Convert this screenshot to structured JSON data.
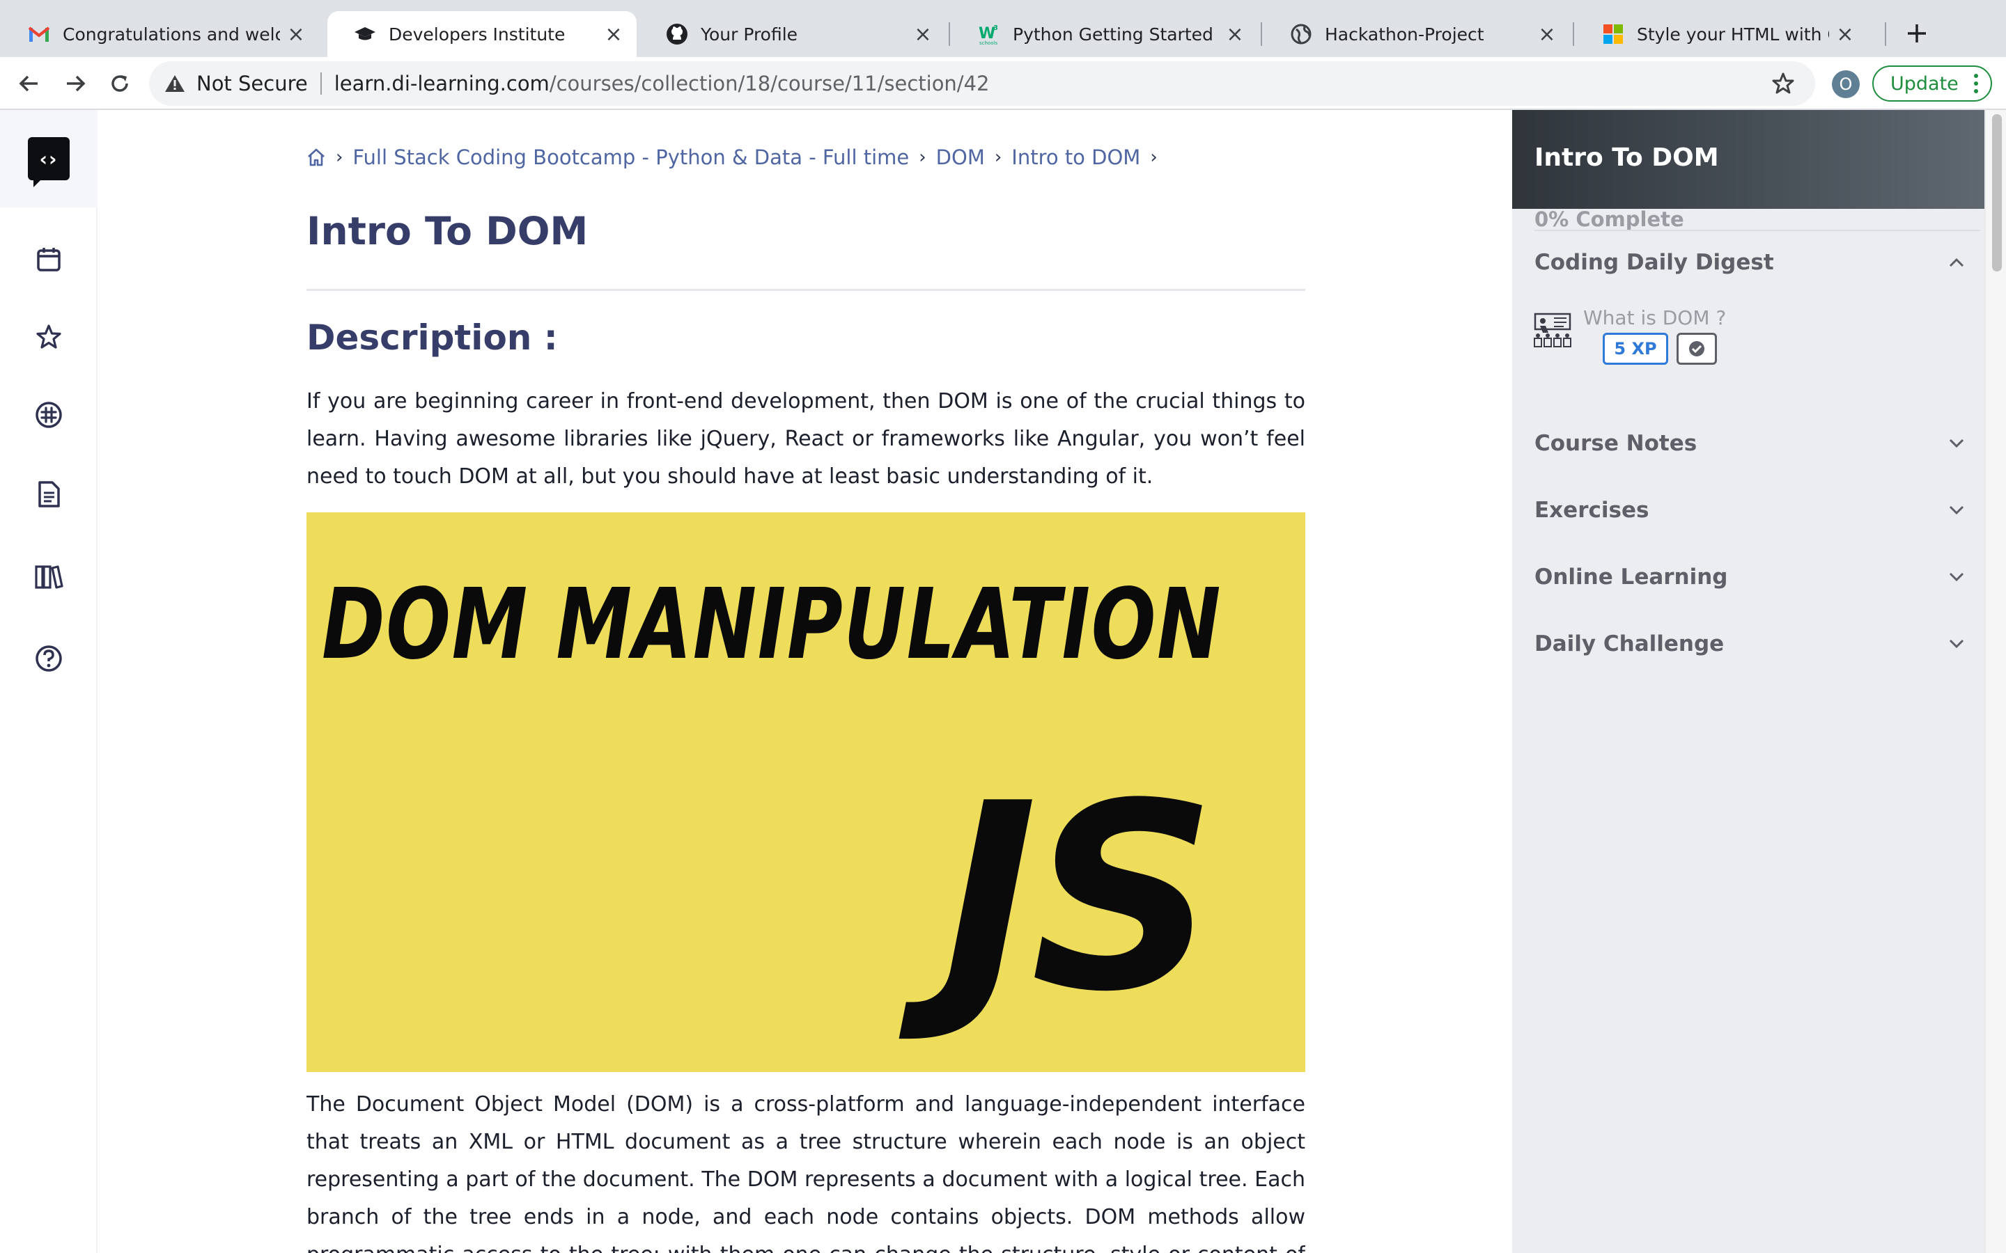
{
  "browser": {
    "tabs": [
      {
        "title": "Congratulations and welcome to the Developers Institute",
        "icon": "gmail-icon"
      },
      {
        "title": "Developers Institute",
        "icon": "graduation-cap-icon"
      },
      {
        "title": "Your Profile",
        "icon": "github-icon"
      },
      {
        "title": "Python Getting Started",
        "icon": "w3schools-icon"
      },
      {
        "title": "Hackathon-Project",
        "icon": "globe-icon"
      },
      {
        "title": "Style your HTML with CSS - Learn",
        "icon": "microsoft-icon"
      }
    ],
    "active_tab": 1,
    "security_label": "Not Secure",
    "url_host": "learn.di-learning.com",
    "url_path": "/courses/collection/18/course/11/section/42",
    "profile_initial": "O",
    "update_label": "Update"
  },
  "breadcrumb": {
    "items": [
      "Full Stack Coding Bootcamp - Python & Data - Full time",
      "DOM",
      "Intro to DOM"
    ]
  },
  "page": {
    "title": "Intro To DOM",
    "description_heading": "Description :",
    "intro_paragraph": "If you are beginning career in front-end development, then DOM is one of the crucial things to learn. Having awesome libraries like jQuery, React or frameworks like Angular, you won’t feel need to touch DOM at all, but you should have at least basic understanding of it.",
    "hero_line1": "DOM MANIPULATION",
    "hero_line2": "JS",
    "body_paragraph": "The Document Object Model (DOM) is a cross-platform and language-independent interface that treats an XML or HTML document as a tree structure wherein each node is an object representing a part of the document. The DOM represents a document with a logical tree. Each branch of the tree ends in a node, and each node contains objects. DOM methods allow programmatic access to the tree; with them one can change the structure, style or content of a"
  },
  "course_panel": {
    "title": "Intro To DOM",
    "progress_label": "0% Complete",
    "progress_percent": 0,
    "sections": [
      {
        "label": "Coding Daily Digest",
        "expanded": true
      },
      {
        "label": "Course Notes",
        "expanded": false
      },
      {
        "label": "Exercises",
        "expanded": false
      },
      {
        "label": "Online Learning",
        "expanded": false
      },
      {
        "label": "Daily Challenge",
        "expanded": false
      }
    ],
    "lesson": {
      "name": "What is DOM ?",
      "xp": "5 XP"
    }
  },
  "colors": {
    "accent": "#363d69",
    "link": "#4f66a3",
    "hero_bg": "#eedc5b",
    "xp_blue": "#2f79d8",
    "update_green": "#1e8e3e"
  }
}
